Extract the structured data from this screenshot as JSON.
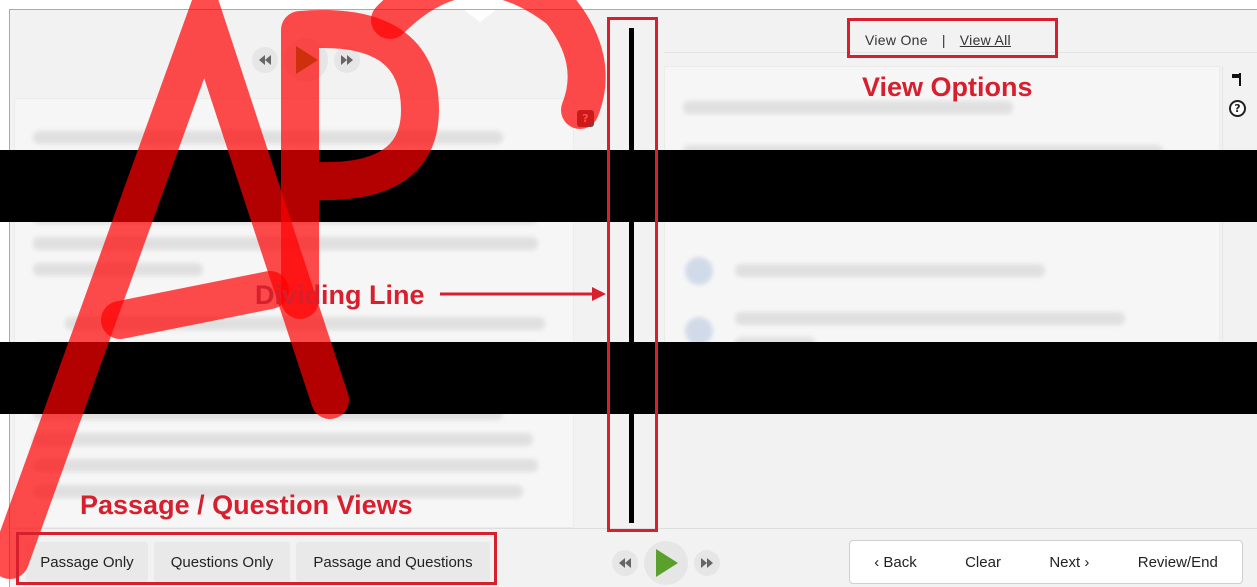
{
  "audio": {
    "rewind_label": "◀◀",
    "forward_label": "▶▶"
  },
  "help": {
    "glyph": "?"
  },
  "view_options": {
    "view_one": "View One",
    "separator": "|",
    "view_all": "View All"
  },
  "bottom": {
    "passage_only": "Passage Only",
    "questions_only": "Questions Only",
    "passage_and_questions": "Passage and Questions",
    "back": "‹ Back",
    "clear": "Clear",
    "next": "Next ›",
    "review_end": "Review/End"
  },
  "annotations": {
    "view_options": "View Options",
    "dividing_line": "Dividing Line",
    "passage_views": "Passage / Question Views"
  },
  "watermark": {
    "text": "APCo"
  },
  "colors": {
    "annotation": "#d71f2e",
    "play": "#5aa02c",
    "frame_border": "#e1a33a",
    "watermark": "#ff0000"
  },
  "icons": {
    "play": "play-icon",
    "rewind": "rewind-icon",
    "forward": "fast-forward-icon",
    "help": "help-icon",
    "flag": "flag-icon"
  }
}
